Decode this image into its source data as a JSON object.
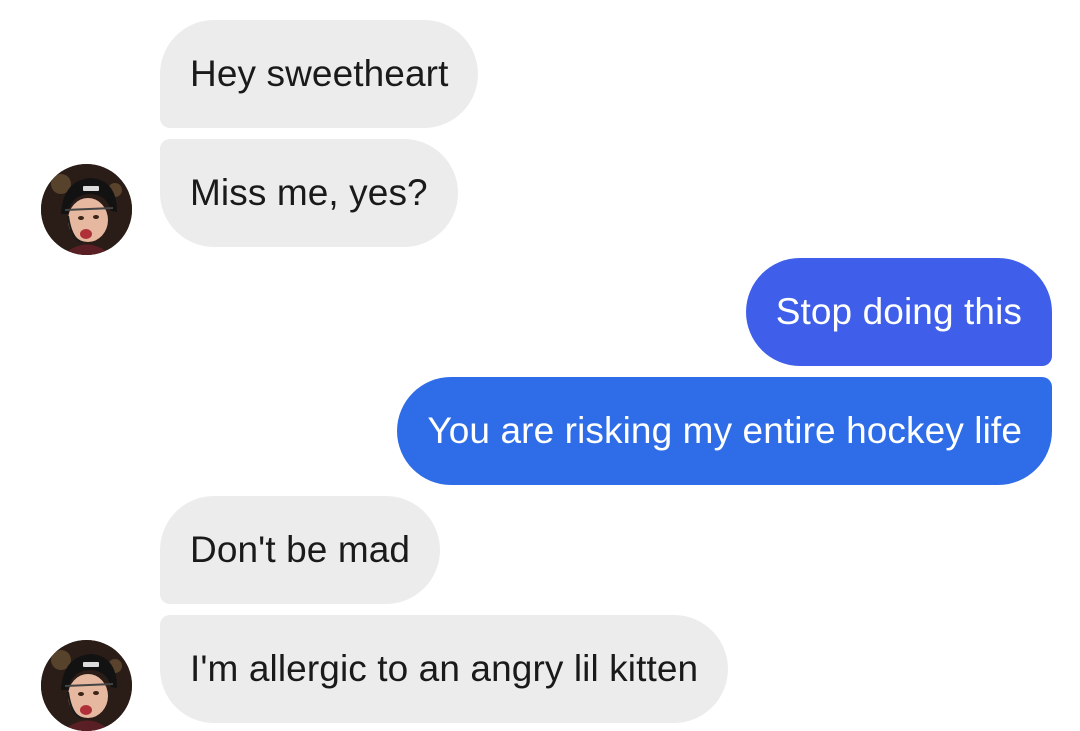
{
  "conversation": {
    "messages": [
      {
        "sender": "contact",
        "text": "Hey sweetheart"
      },
      {
        "sender": "contact",
        "text": "Miss me, yes?"
      },
      {
        "sender": "me",
        "text": "Stop doing this"
      },
      {
        "sender": "me",
        "text": "You are risking my entire hockey life"
      },
      {
        "sender": "contact",
        "text": "Don't be mad"
      },
      {
        "sender": "contact",
        "text": "I'm allergic to an angry lil kitten"
      }
    ]
  },
  "colors": {
    "incoming_bubble": "#ececec",
    "incoming_text": "#1a1a1a",
    "outgoing_bubble_top": "#3f5fea",
    "outgoing_bubble_bottom": "#2f6de8",
    "outgoing_text": "#ffffff"
  },
  "icons": {
    "contact_avatar": "hockey-player-avatar"
  }
}
